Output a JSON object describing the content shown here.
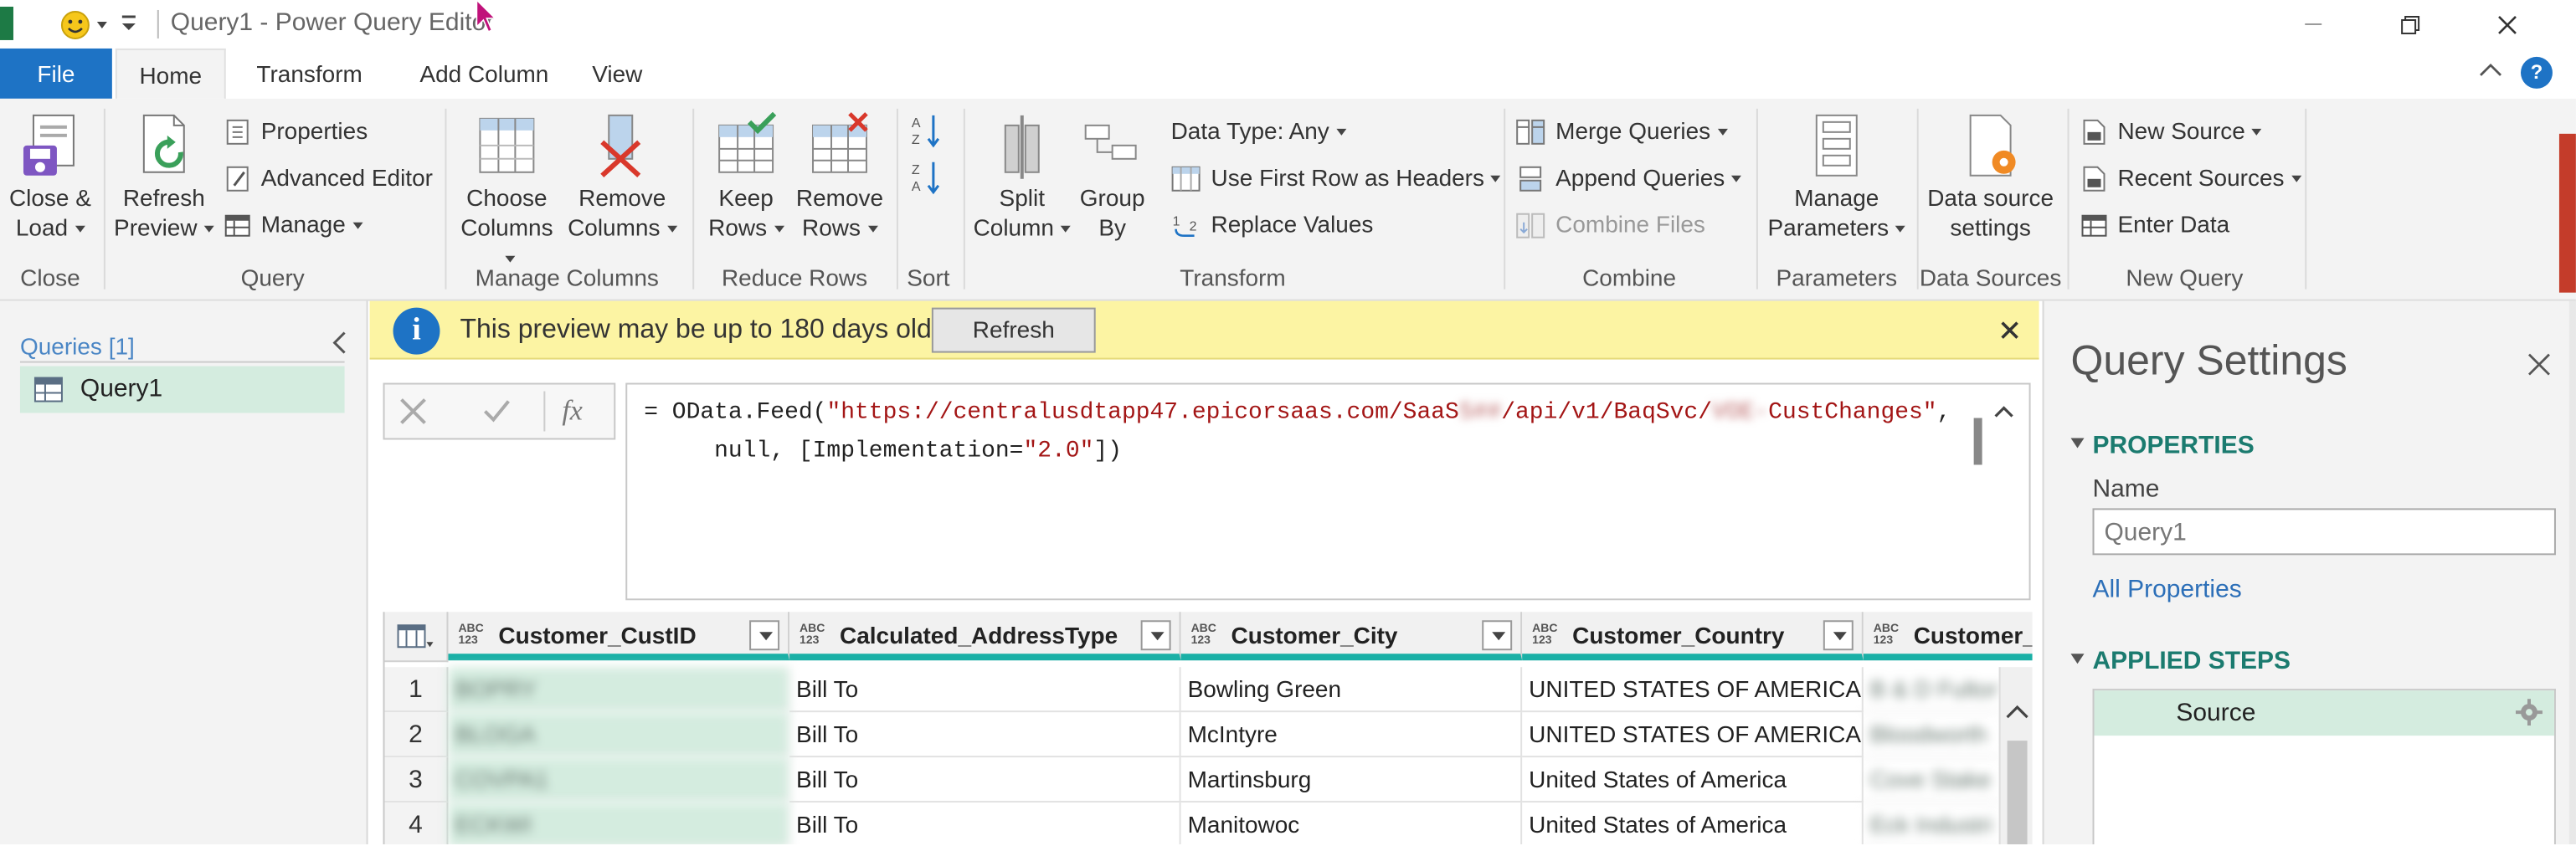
{
  "window": {
    "title": "Query1 - Power Query Editor"
  },
  "tabs": {
    "file": "File",
    "home": "Home",
    "transform": "Transform",
    "add_column": "Add Column",
    "view": "View"
  },
  "ribbon": {
    "close_load": {
      "line1": "Close &",
      "line2": "Load"
    },
    "refresh_preview": {
      "line1": "Refresh",
      "line2": "Preview"
    },
    "properties": "Properties",
    "advanced_editor": "Advanced Editor",
    "manage": "Manage",
    "choose_columns": {
      "line1": "Choose",
      "line2": "Columns"
    },
    "remove_columns": {
      "line1": "Remove",
      "line2": "Columns"
    },
    "keep_rows": {
      "line1": "Keep",
      "line2": "Rows"
    },
    "remove_rows": {
      "line1": "Remove",
      "line2": "Rows"
    },
    "split_column": {
      "line1": "Split",
      "line2": "Column"
    },
    "group_by": {
      "line1": "Group",
      "line2": "By"
    },
    "data_type": "Data Type: Any",
    "use_first_row": "Use First Row as Headers",
    "replace_values": "Replace Values",
    "merge_queries": "Merge Queries",
    "append_queries": "Append Queries",
    "combine_files": "Combine Files",
    "manage_parameters": {
      "line1": "Manage",
      "line2": "Parameters"
    },
    "data_source_settings": {
      "line1": "Data source",
      "line2": "settings"
    },
    "new_source": "New Source",
    "recent_sources": "Recent Sources",
    "enter_data": "Enter Data",
    "groups": {
      "close": "Close",
      "query": "Query",
      "manage_columns": "Manage Columns",
      "reduce_rows": "Reduce Rows",
      "sort": "Sort",
      "transform": "Transform",
      "combine": "Combine",
      "parameters": "Parameters",
      "data_sources": "Data Sources",
      "new_query": "New Query"
    }
  },
  "queries": {
    "header": "Queries [1]",
    "items": [
      {
        "name": "Query1"
      }
    ]
  },
  "banner": {
    "message": "This preview may be up to 180 days old.",
    "button": "Refresh"
  },
  "formula": {
    "prefix": "= OData.Feed(",
    "url_part1": "\"https://centralusdtapp47.epicorsaas.com/SaaS",
    "url_blur1": "5##",
    "url_part2": "/api/v1/BaqSvc/",
    "url_blur2": "VOE-",
    "url_part3": "CustChanges\"",
    "line1_end": ",",
    "line2_prefix": "null, [Implementation=",
    "line2_str": "\"2.0\"",
    "line2_end": "])"
  },
  "grid": {
    "type_label": {
      "top": "ABC",
      "bottom": "123"
    },
    "columns": [
      "Customer_CustID",
      "Calculated_AddressType",
      "Customer_City",
      "Customer_Country",
      "Customer_I"
    ],
    "rows": [
      {
        "num": "1",
        "custid": "BOPRY",
        "addr": "Bill To",
        "city": "Bowling Green",
        "country": "UNITED STATES OF AMERICA",
        "name": "B & D Fulton"
      },
      {
        "num": "2",
        "custid": "BLOGA",
        "addr": "Bill To",
        "city": "McIntyre",
        "country": "UNITED STATES OF AMERICA",
        "name": "Bloodworth"
      },
      {
        "num": "3",
        "custid": "COVPA1",
        "addr": "Bill To",
        "city": "Martinsburg",
        "country": "United States of America",
        "name": "Cove Stake E"
      },
      {
        "num": "4",
        "custid": "ECKWI",
        "addr": "Bill To",
        "city": "Manitowoc",
        "country": "United States of America",
        "name": "Eck Industri"
      }
    ]
  },
  "settings": {
    "title": "Query Settings",
    "properties_header": "PROPERTIES",
    "name_label": "Name",
    "name_value": "Query1",
    "all_properties": "All Properties",
    "applied_steps_header": "APPLIED STEPS",
    "steps": [
      {
        "name": "Source"
      }
    ]
  },
  "colors": {
    "accent": "#1e73c5",
    "teal": "#1ab0a6",
    "banner": "#fcf4a3",
    "selected": "#d4ecdf"
  }
}
